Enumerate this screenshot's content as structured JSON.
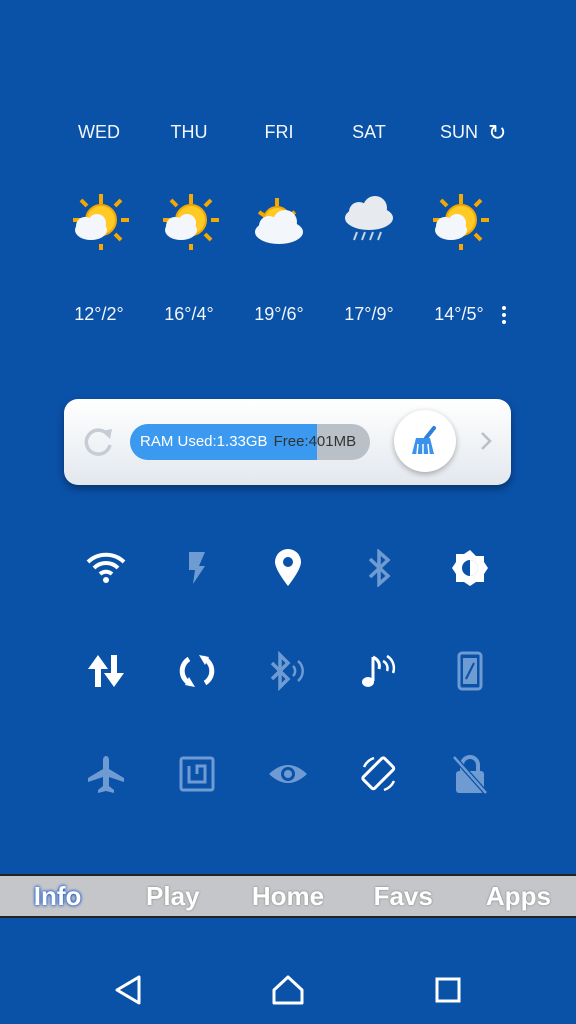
{
  "weather": {
    "days": [
      "WED",
      "THU",
      "FRI",
      "SAT",
      "SUN"
    ],
    "temps": [
      "12°/2°",
      "16°/4°",
      "19°/6°",
      "17°/9°",
      "14°/5°"
    ],
    "icons": [
      "sun-cloud-icon",
      "sun-cloud-icon",
      "sun-cloud-icon",
      "rain-cloud-icon",
      "sun-cloud-icon"
    ],
    "refresh_icon": "↻"
  },
  "ram": {
    "label": "RAM Used:1.33GB",
    "free": "Free:401MB",
    "used_fraction": 0.78
  },
  "toggles": {
    "row1": [
      {
        "name": "wifi-icon",
        "active": true
      },
      {
        "name": "flashlight-icon",
        "active": false
      },
      {
        "name": "location-icon",
        "active": true
      },
      {
        "name": "bluetooth-icon",
        "active": false
      },
      {
        "name": "brightness-icon",
        "active": true
      }
    ],
    "row2": [
      {
        "name": "data-icon",
        "active": true
      },
      {
        "name": "sync-icon",
        "active": true
      },
      {
        "name": "bluetooth-audio-icon",
        "active": false
      },
      {
        "name": "audio-icon",
        "active": true
      },
      {
        "name": "screen-icon",
        "active": false
      }
    ],
    "row3": [
      {
        "name": "airplane-icon",
        "active": false
      },
      {
        "name": "nfc-icon",
        "active": false
      },
      {
        "name": "eye-icon",
        "active": false
      },
      {
        "name": "rotate-icon",
        "active": true
      },
      {
        "name": "lock-off-icon",
        "active": false
      }
    ]
  },
  "tabs": [
    {
      "label": "Info",
      "active": true
    },
    {
      "label": "Play",
      "active": false
    },
    {
      "label": "Home",
      "active": false
    },
    {
      "label": "Favs",
      "active": false
    },
    {
      "label": "Apps",
      "active": false
    }
  ],
  "colors": {
    "background": "#0a51a8",
    "active_icon": "#ffffff",
    "inactive_icon": "#6f9bd3",
    "ram_fill": "#3b9af0"
  }
}
